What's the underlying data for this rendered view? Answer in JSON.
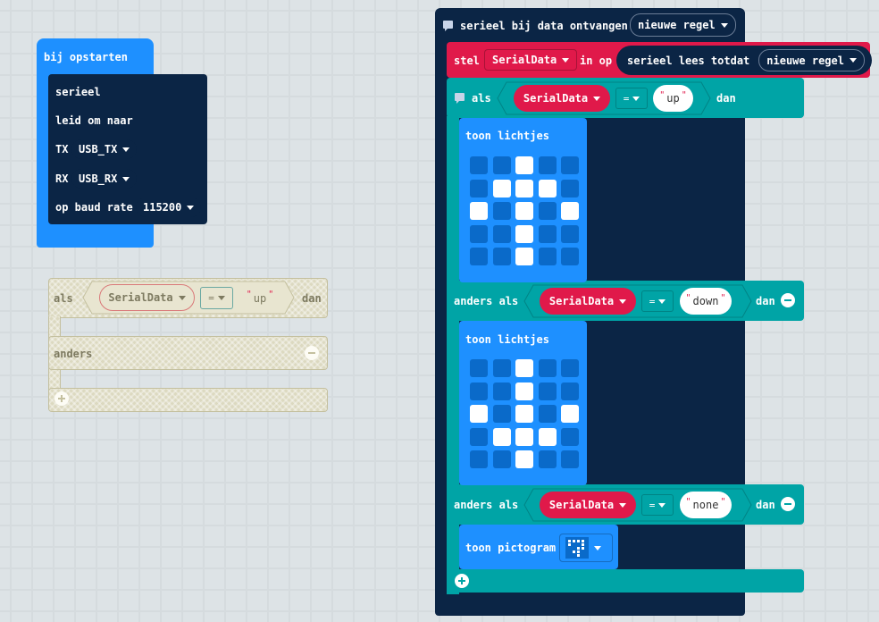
{
  "colors": {
    "navy": "#0b2545",
    "blue": "#1e90ff",
    "teal": "#00a4a6",
    "red": "#e0194a",
    "workspace": "#ecf0f1"
  },
  "start": {
    "hat_label": "bij opstarten",
    "serial_label": "serieel",
    "redirect_label": "leid om naar",
    "tx_label": "TX",
    "tx_value": "USB_TX",
    "rx_label": "RX",
    "rx_value": "USB_RX",
    "baud_label": "op baud rate",
    "baud_value": "115200"
  },
  "loose": {
    "if_label": "als",
    "var": "SerialData",
    "op": "=",
    "str": "up",
    "then": "dan",
    "else_label": "anders"
  },
  "main": {
    "hat_label": "serieel bij data ontvangen",
    "hat_option": "nieuwe regel",
    "set_label": "stel",
    "set_var": "SerialData",
    "set_to": "in op",
    "read_label": "serieel lees totdat",
    "read_option": "nieuwe regel",
    "if_label": "als",
    "elif_label": "anders als",
    "then": "dan",
    "var": "SerialData",
    "op": "=",
    "cond1": "up",
    "cond2": "down",
    "cond3": "none",
    "show_leds": "toon lichtjes",
    "show_icon": "toon pictogram",
    "leds1": [
      [
        0,
        0,
        1,
        0,
        0
      ],
      [
        0,
        1,
        1,
        1,
        0
      ],
      [
        1,
        0,
        1,
        0,
        1
      ],
      [
        0,
        0,
        1,
        0,
        0
      ],
      [
        0,
        0,
        1,
        0,
        0
      ]
    ],
    "leds2": [
      [
        0,
        0,
        1,
        0,
        0
      ],
      [
        0,
        0,
        1,
        0,
        0
      ],
      [
        1,
        0,
        1,
        0,
        1
      ],
      [
        0,
        1,
        1,
        1,
        0
      ],
      [
        0,
        0,
        1,
        0,
        0
      ]
    ]
  }
}
